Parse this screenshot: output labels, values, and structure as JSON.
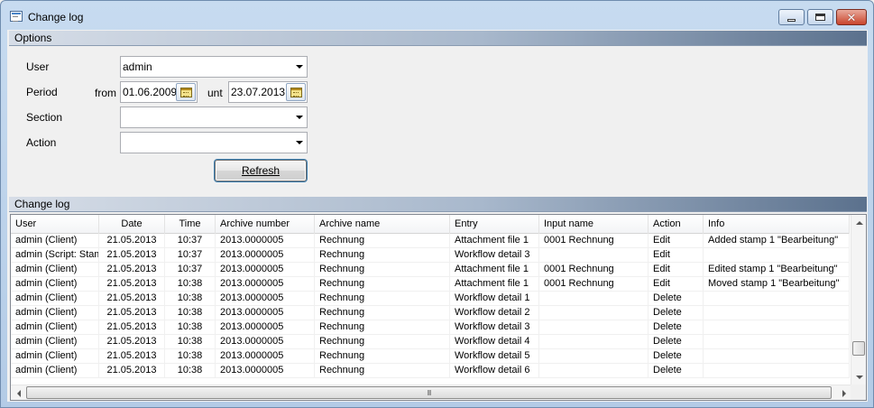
{
  "window": {
    "title": "Change log"
  },
  "options": {
    "header": "Options",
    "user_label": "User",
    "user_value": "admin",
    "period_label": "Period",
    "from_label": "from",
    "from_value": "01.06.2009",
    "until_label": "unt",
    "until_value": "23.07.2013",
    "section_label": "Section",
    "section_value": "",
    "action_label": "Action",
    "action_value": "",
    "refresh_label": "Refresh"
  },
  "log": {
    "header": "Change log",
    "columns": [
      "User",
      "Date",
      "Time",
      "Archive number",
      "Archive name",
      "Entry",
      "Input name",
      "Action",
      "Info"
    ],
    "rows": [
      [
        "admin (Client)",
        "21.05.2013",
        "10:37",
        "2013.0000005",
        "Rechnung",
        "Attachment file 1",
        "0001 Rechnung",
        "Edit",
        "Added stamp 1 \"Bearbeitung\""
      ],
      [
        "admin (Script: Stamp",
        "21.05.2013",
        "10:37",
        "2013.0000005",
        "Rechnung",
        "Workflow detail 3",
        "",
        "Edit",
        ""
      ],
      [
        "admin (Client)",
        "21.05.2013",
        "10:37",
        "2013.0000005",
        "Rechnung",
        "Attachment file 1",
        "0001 Rechnung",
        "Edit",
        "Edited stamp 1 \"Bearbeitung\""
      ],
      [
        "admin (Client)",
        "21.05.2013",
        "10:38",
        "2013.0000005",
        "Rechnung",
        "Attachment file 1",
        "0001 Rechnung",
        "Edit",
        "Moved stamp 1 \"Bearbeitung\""
      ],
      [
        "admin (Client)",
        "21.05.2013",
        "10:38",
        "2013.0000005",
        "Rechnung",
        "Workflow detail 1",
        "",
        "Delete",
        ""
      ],
      [
        "admin (Client)",
        "21.05.2013",
        "10:38",
        "2013.0000005",
        "Rechnung",
        "Workflow detail 2",
        "",
        "Delete",
        ""
      ],
      [
        "admin (Client)",
        "21.05.2013",
        "10:38",
        "2013.0000005",
        "Rechnung",
        "Workflow detail 3",
        "",
        "Delete",
        ""
      ],
      [
        "admin (Client)",
        "21.05.2013",
        "10:38",
        "2013.0000005",
        "Rechnung",
        "Workflow detail 4",
        "",
        "Delete",
        ""
      ],
      [
        "admin (Client)",
        "21.05.2013",
        "10:38",
        "2013.0000005",
        "Rechnung",
        "Workflow detail 5",
        "",
        "Delete",
        ""
      ],
      [
        "admin (Client)",
        "21.05.2013",
        "10:38",
        "2013.0000005",
        "Rechnung",
        "Workflow detail 6",
        "",
        "Delete",
        ""
      ]
    ],
    "horizontal_scroll_grip": "III"
  },
  "icons": {
    "window": "change-log-window-icon",
    "calendar": "calendar-icon",
    "dropdown": "chevron-down-icon"
  },
  "colors": {
    "title_gradient_top": "#c7dbf0",
    "group_header_dark": "#5b718d",
    "close_button": "#c9442c",
    "grid_border": "#828790"
  }
}
